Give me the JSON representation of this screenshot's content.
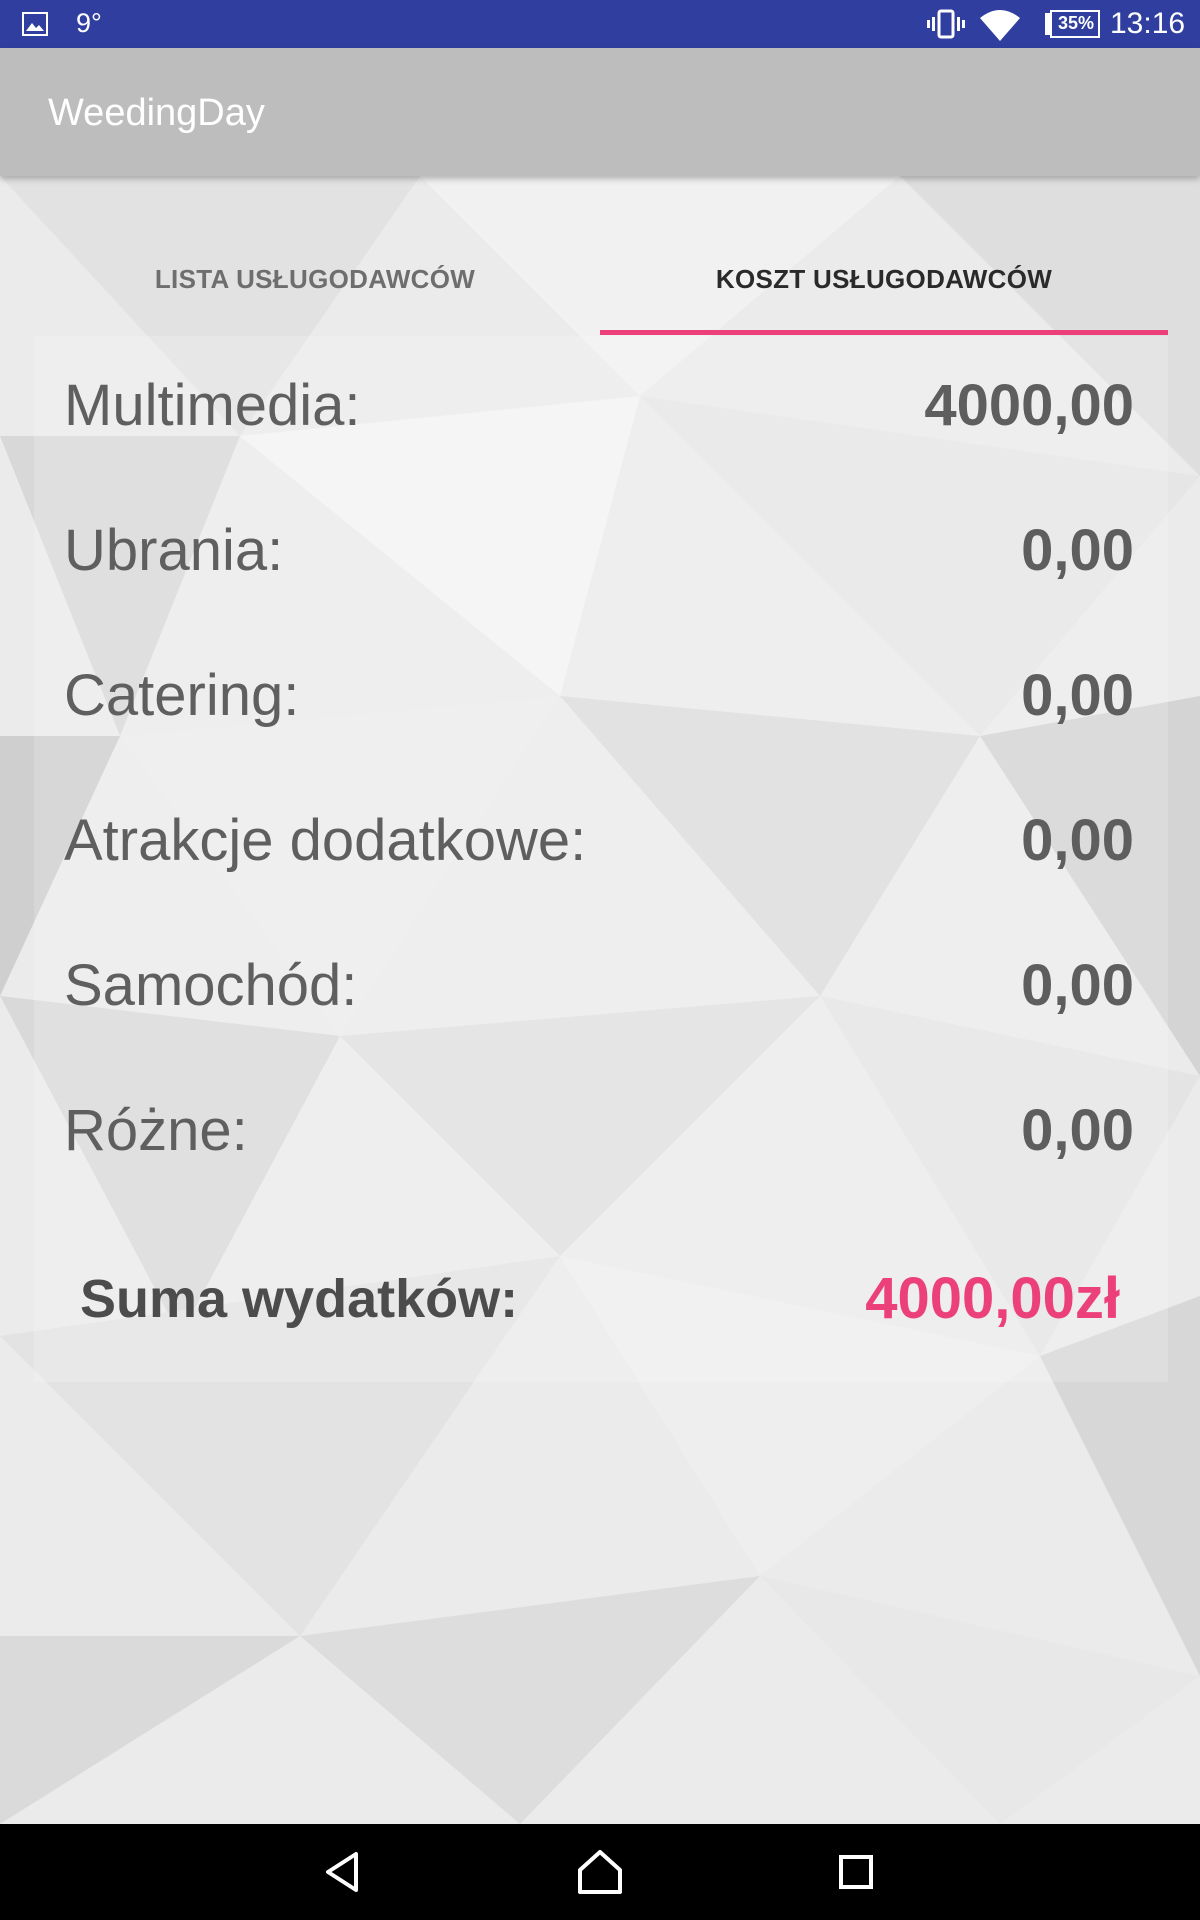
{
  "status_bar": {
    "temperature": "9°",
    "battery": "35%",
    "time": "13:16",
    "icons": [
      "gallery-icon",
      "vibrate-icon",
      "wifi-icon",
      "battery-icon"
    ]
  },
  "app_bar": {
    "title": "WeedingDay"
  },
  "tabs": [
    {
      "label": "LISTA USŁUGODAWCÓW",
      "selected": false
    },
    {
      "label": "KOSZT USŁUGODAWCÓW",
      "selected": true
    }
  ],
  "costs": {
    "rows": [
      {
        "label": "Multimedia:",
        "value": "4000,00"
      },
      {
        "label": "Ubrania:",
        "value": "0,00"
      },
      {
        "label": "Catering:",
        "value": "0,00"
      },
      {
        "label": "Atrakcje dodatkowe:",
        "value": "0,00"
      },
      {
        "label": "Samochód:",
        "value": "0,00"
      },
      {
        "label": "Różne:",
        "value": "0,00"
      }
    ],
    "sum_label": "Suma wydatków:",
    "sum_value": "4000,00zł"
  },
  "nav_bar": {
    "icons": [
      "back-icon",
      "home-icon",
      "recent-apps-icon"
    ]
  },
  "colors": {
    "status_bar": "#303f9f",
    "app_bar": "#bdbdbd",
    "accent": "#ec407a",
    "nav_bar": "#000000"
  }
}
